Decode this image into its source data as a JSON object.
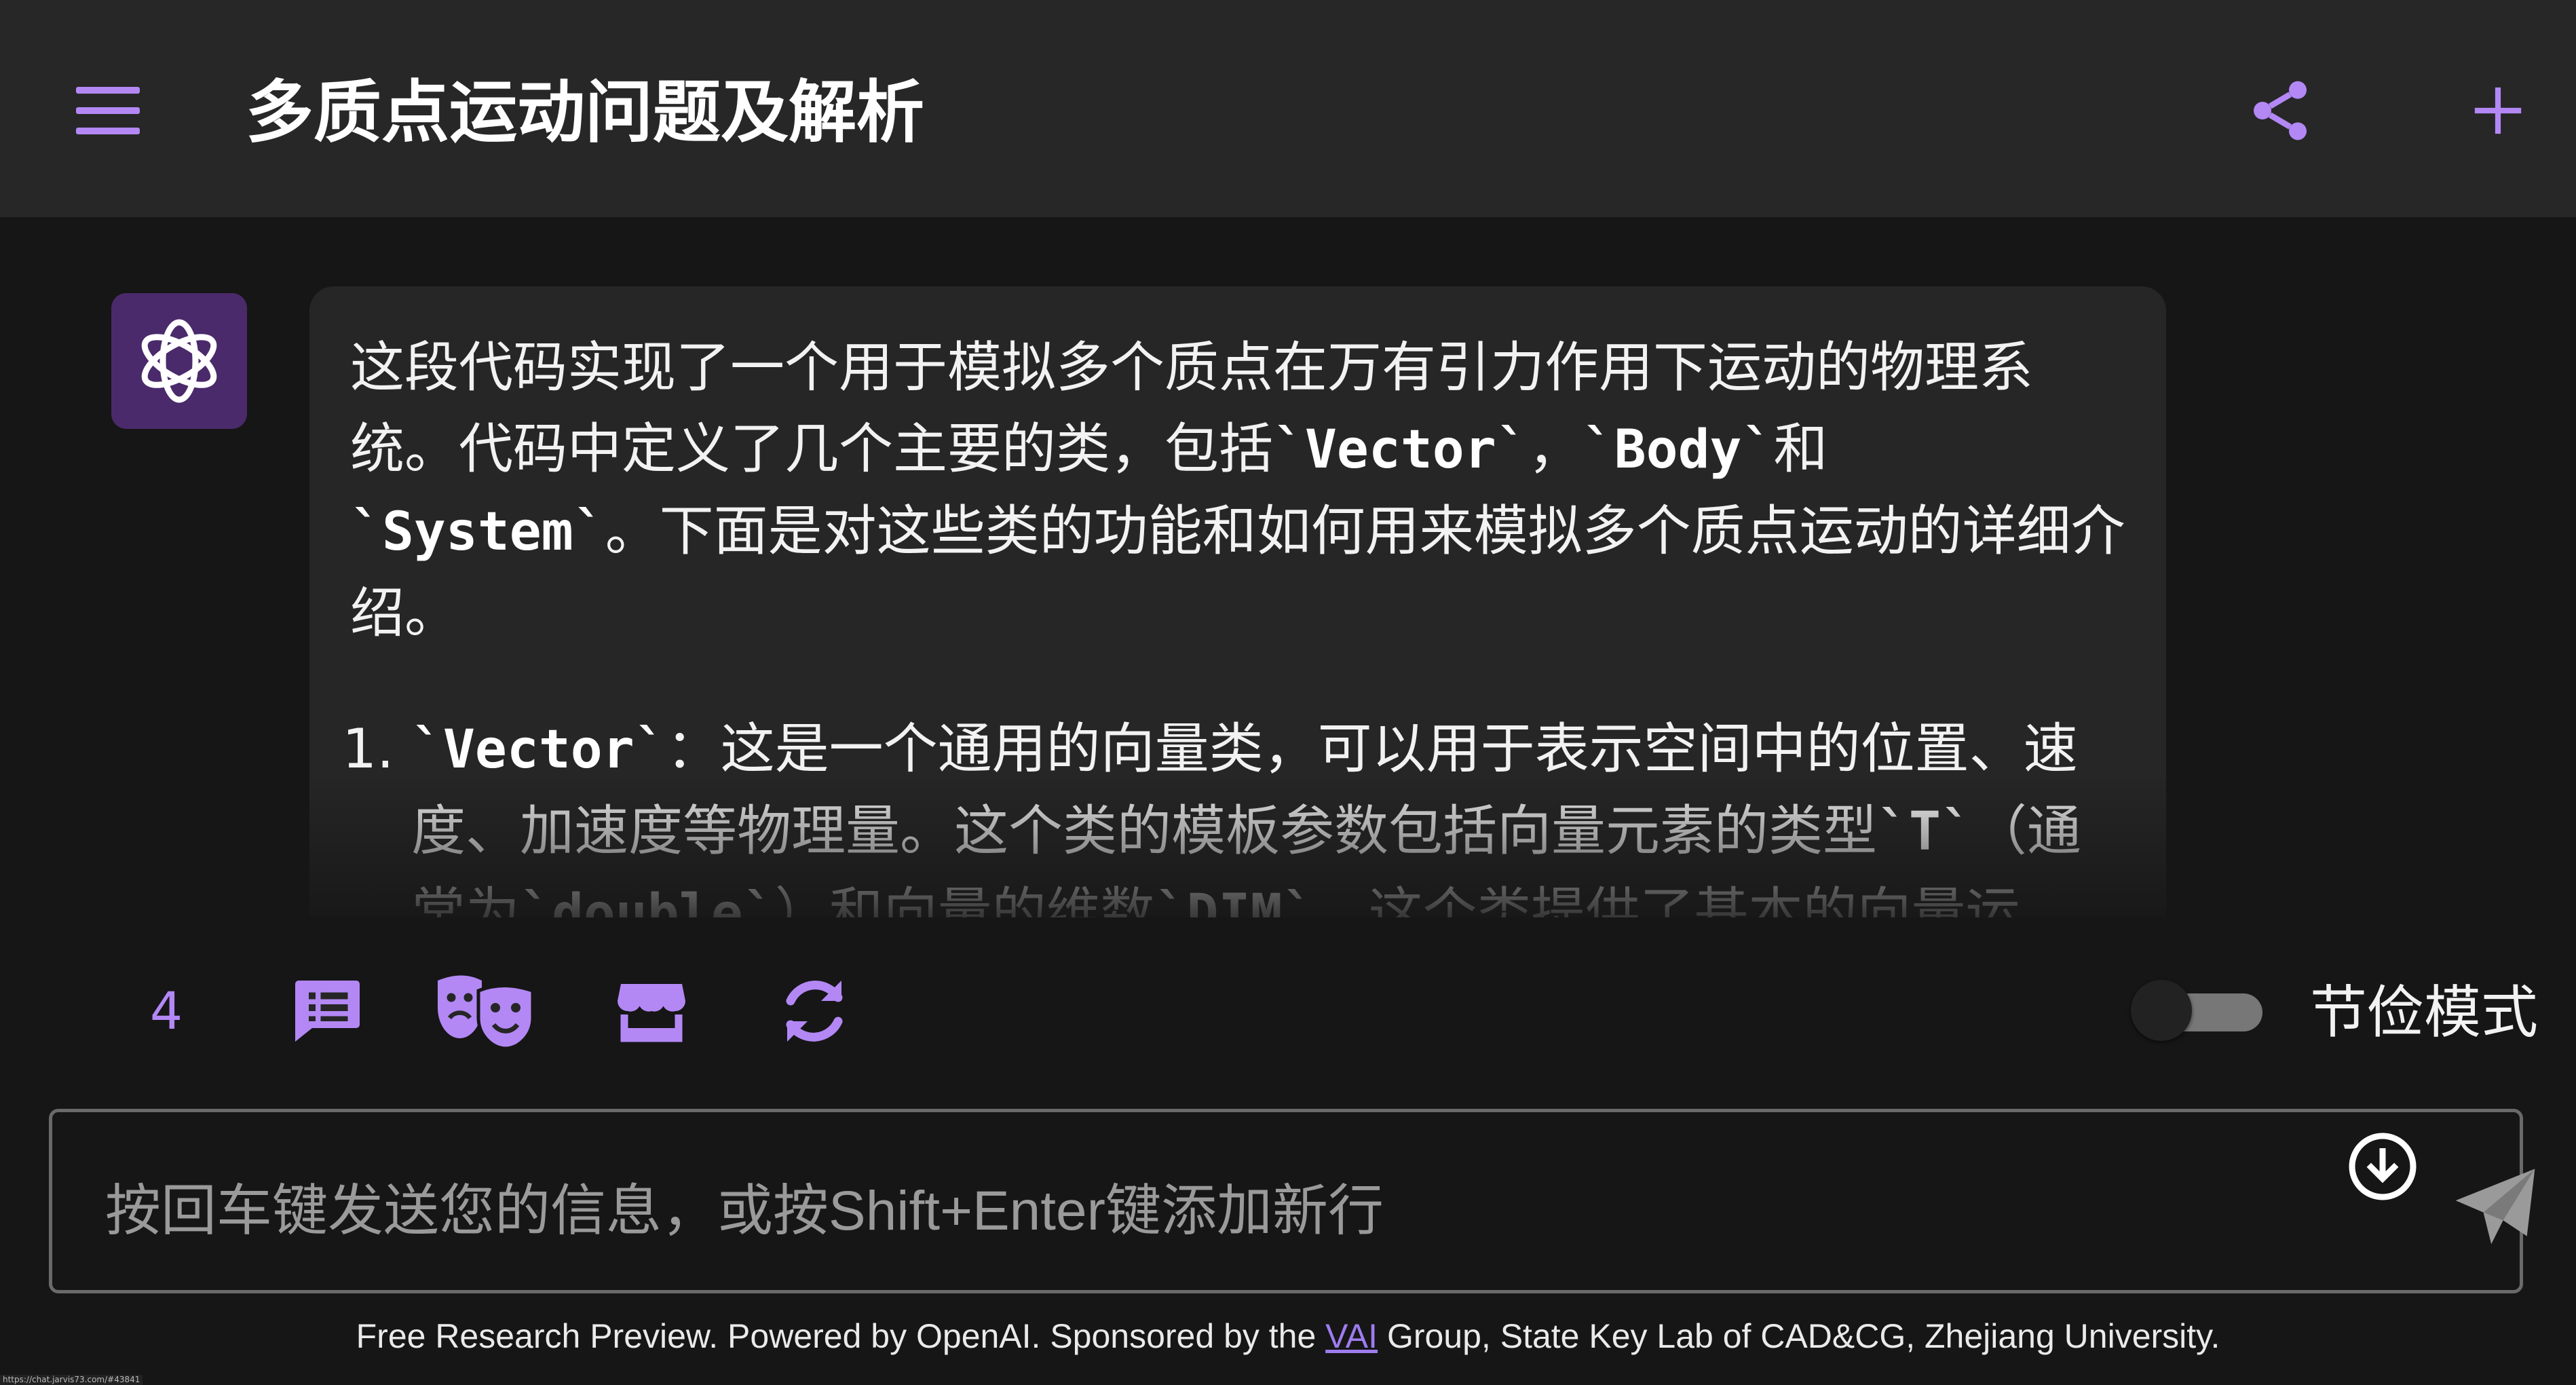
{
  "header": {
    "title": "多质点运动问题及解析"
  },
  "message": {
    "intro_1": "这段代码实现了一个用于模拟多个质点在万有引力作用下运动的物理系统。代码中定义了几个主要的类，包括",
    "code_vector": "`Vector`",
    "sep_1": "，",
    "code_body": "`Body`",
    "sep_2": "和",
    "code_system": "`System`",
    "intro_2": "。下面是对这些类的功能和如何用来模拟多个质点运动的详细介绍。",
    "item1_code": "`Vector`",
    "item1_a": "：这是一个通用的向量类，可以用于表示空间中的位置、速度、加速度等物理量。这个类的模板参数包括向量元素的类型",
    "item1_code_t": "`T`",
    "item1_b": "（通常为",
    "item1_code_double": "`double`",
    "item1_c": "）和向量的维数",
    "item1_code_dim": "`DIM`",
    "item1_d": "。这个类提供了基本的向量运算，如加法、减法、数乘、除法、向量模长计算、向量距离计算等"
  },
  "toolbar": {
    "count": "4",
    "toggle_label": "节俭模式",
    "toggle_on": false
  },
  "input": {
    "placeholder": "按回车键发送您的信息，或按Shift+Enter键添加新行"
  },
  "footer": {
    "text_before": "Free Research Preview. Powered by OpenAI. Sponsored by the ",
    "link": "VAI",
    "text_after": " Group, State Key Lab of CAD&CG, Zhejiang University."
  },
  "status_url": "https://chat.jarvis73.com/#43841",
  "colors": {
    "accent": "#b388f5",
    "header_bg": "#272727",
    "page_bg": "#161616",
    "bubble_bg": "#262626",
    "avatar_bg": "#4a2a6b"
  },
  "icons": {
    "menu": "menu-icon",
    "share": "share-icon",
    "new": "plus-icon",
    "avatar": "openai-logo-icon",
    "prompts": "prompt-list-icon",
    "roles": "theater-masks-icon",
    "store": "store-icon",
    "refresh": "refresh-icon",
    "download": "download-icon",
    "send": "send-icon"
  }
}
